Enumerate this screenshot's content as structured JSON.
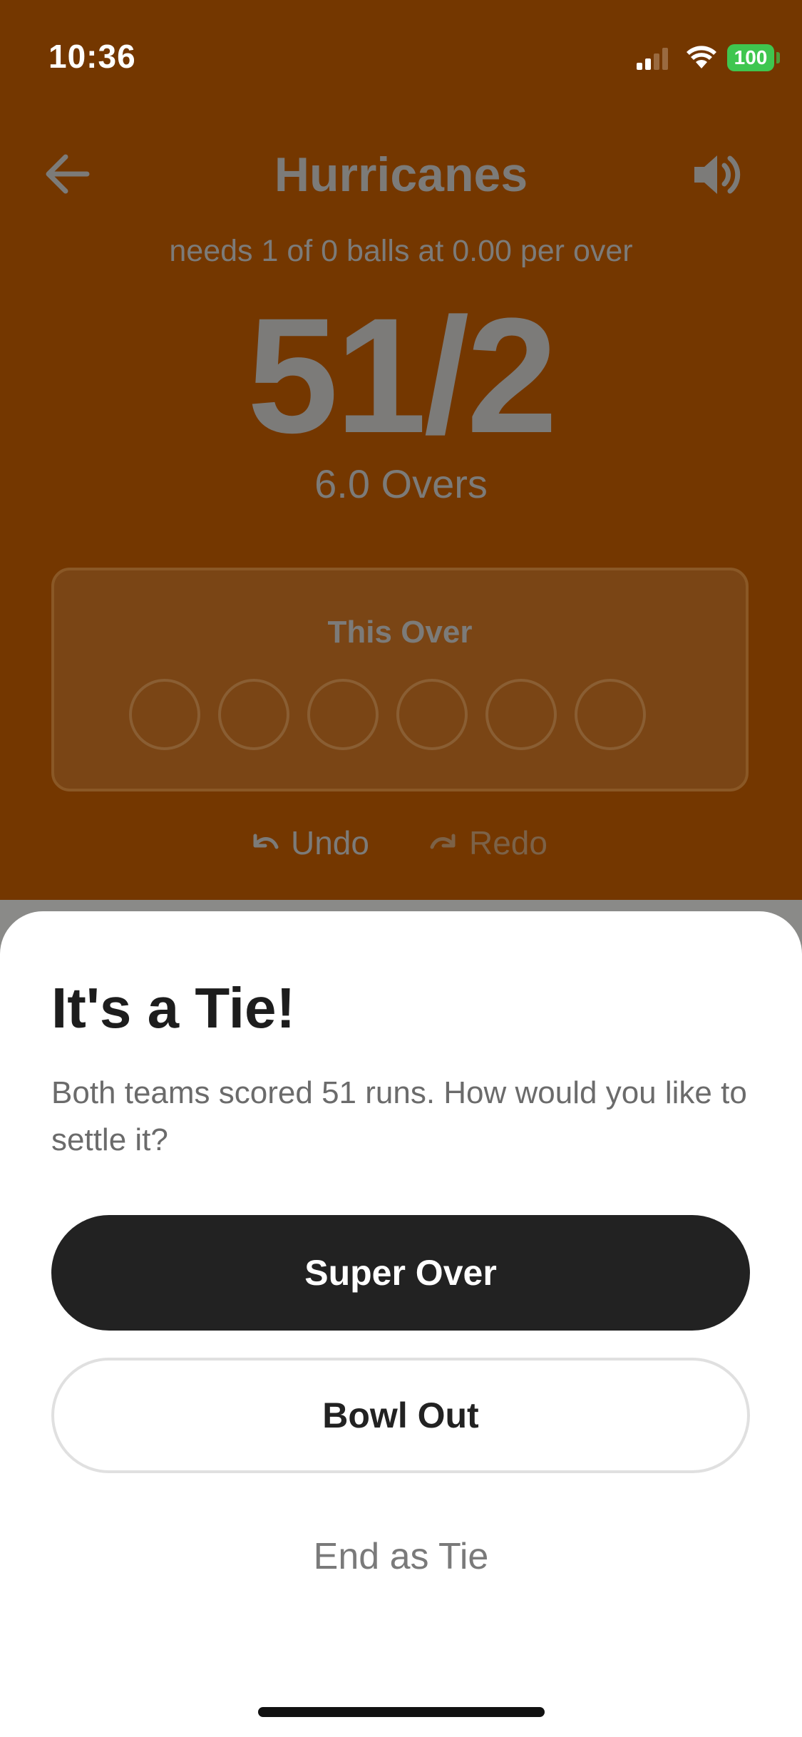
{
  "status_bar": {
    "time": "10:36",
    "battery": "100",
    "battery_color": "#3fc64f"
  },
  "header": {
    "team": "Hurricanes",
    "back_icon": "arrow-left-icon",
    "sound_icon": "speaker-icon"
  },
  "scoreboard": {
    "needs": "needs 1 of 0 balls at 0.00 per over",
    "score": "51/2",
    "overs": "6.0 Overs"
  },
  "this_over": {
    "title": "This Over",
    "balls": [
      "",
      "",
      "",
      "",
      "",
      ""
    ]
  },
  "history": {
    "undo": "Undo",
    "redo": "Redo"
  },
  "tie_sheet": {
    "title": "It's a Tie!",
    "message": "Both teams scored 51 runs. How would you like to settle it?",
    "super_over": "Super Over",
    "bowl_out": "Bowl Out",
    "end_as_tie": "End as Tie"
  },
  "colors": {
    "background": "#743700",
    "primary_button": "#222222"
  }
}
